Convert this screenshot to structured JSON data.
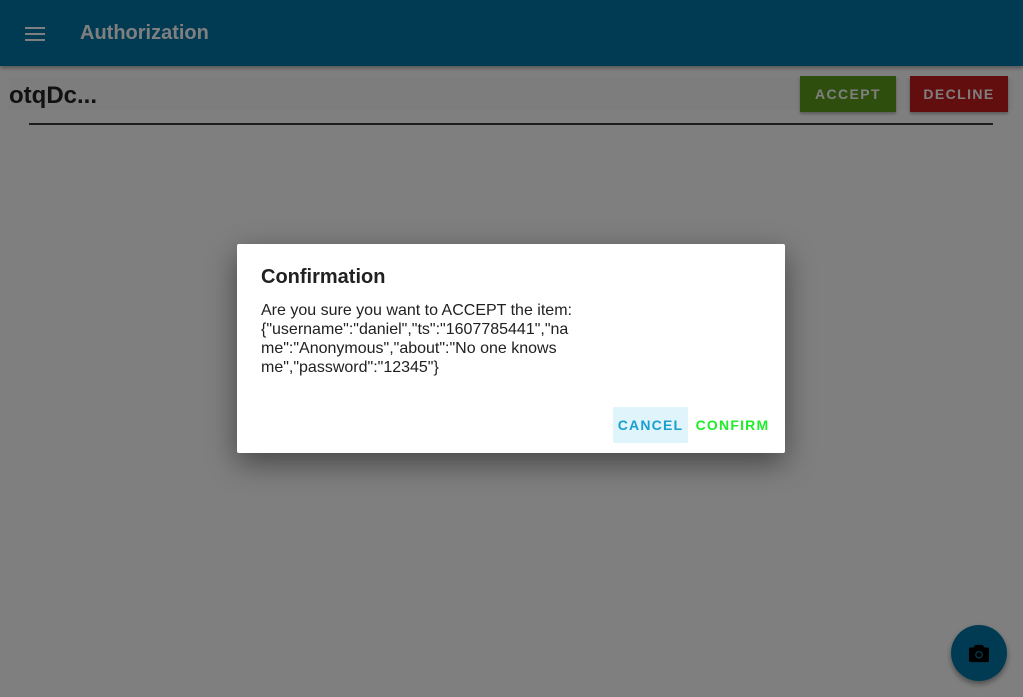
{
  "app_bar": {
    "menu_icon": "menu-icon",
    "title": "Authorization",
    "color": "#0277a7"
  },
  "item": {
    "id": "otqDc...",
    "accept_label": "ACCEPT",
    "decline_label": "DECLINE",
    "accept_color": "#5d9c1d",
    "decline_color": "#c41c1c"
  },
  "fab": {
    "icon": "camera-icon"
  },
  "dialog": {
    "title": "Confirmation",
    "message": "Are you sure you want to ACCEPT the item: {\"username\":\"daniel\",\"ts\":\"1607785441\",\"name\":\"Anonymous\",\"about\":\"No one knows me\",\"password\":\"12345\"}",
    "cancel_label": "CANCEL",
    "confirm_label": "CONFIRM",
    "cancel_color": "#1a9fd0",
    "confirm_color": "#1eed2a"
  }
}
